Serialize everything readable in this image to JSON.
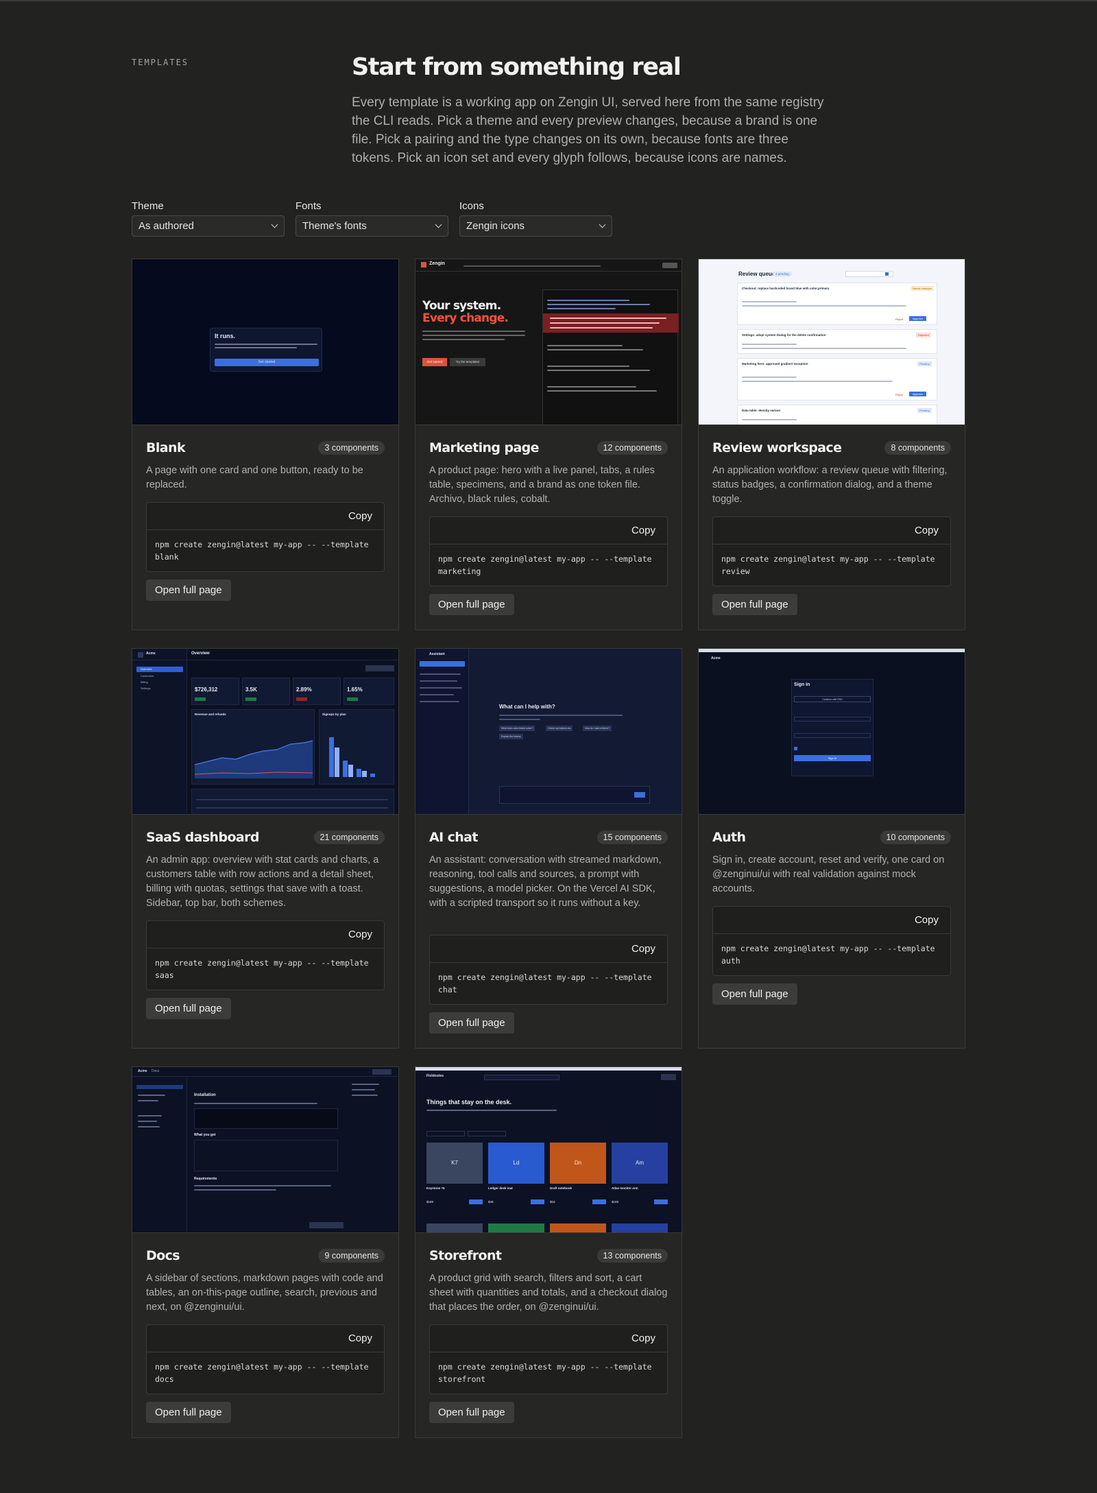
{
  "header": {
    "eyebrow": "TEMPLATES",
    "title": "Start from something real",
    "lede": "Every template is a working app on Zengin UI, served here from the same registry the CLI reads. Pick a theme and every preview changes, because a brand is one file. Pick a pairing and the type changes on its own, because fonts are three tokens. Pick an icon set and every glyph follows, because icons are names."
  },
  "filters": [
    {
      "label": "Theme",
      "value": "As authored"
    },
    {
      "label": "Fonts",
      "value": "Theme's fonts"
    },
    {
      "label": "Icons",
      "value": "Zengin icons"
    }
  ],
  "copy_label": "Copy",
  "open_label": "Open full page",
  "templates": [
    {
      "title": "Blank",
      "badge": "3 components",
      "desc": "A page with one card and one button, ready to be replaced.",
      "cmd1": "npm create zengin@latest my-app -- --template",
      "cmd2": "blank"
    },
    {
      "title": "Marketing page",
      "badge": "12 components",
      "desc": "A product page: hero with a live panel, tabs, a rules table, specimens, and a brand as one token file. Archivo, black rules, cobalt.",
      "cmd1": "npm create zengin@latest my-app -- --template",
      "cmd2": "marketing"
    },
    {
      "title": "Review workspace",
      "badge": "8 components",
      "desc": "An application workflow: a review queue with filtering, status badges, a confirmation dialog, and a theme toggle.",
      "cmd1": "npm create zengin@latest my-app -- --template",
      "cmd2": "review"
    },
    {
      "title": "SaaS dashboard",
      "badge": "21 components",
      "desc": "An admin app: overview with stat cards and charts, a customers table with row actions and a detail sheet, billing with quotas, settings that save with a toast. Sidebar, top bar, both schemes.",
      "cmd1": "npm create zengin@latest my-app -- --template",
      "cmd2": "saas"
    },
    {
      "title": "AI chat",
      "badge": "15 components",
      "desc": "An assistant: conversation with streamed markdown, reasoning, tool calls and sources, a prompt with suggestions, a model picker. On the Vercel AI SDK, with a scripted transport so it runs without a key.",
      "cmd1": "npm create zengin@latest my-app -- --template",
      "cmd2": "chat"
    },
    {
      "title": "Auth",
      "badge": "10 components",
      "desc": "Sign in, create account, reset and verify, one card on @zenginui/ui with real validation against mock accounts.",
      "cmd1": "npm create zengin@latest my-app -- --template",
      "cmd2": "auth"
    },
    {
      "title": "Docs",
      "badge": "9 components",
      "desc": "A sidebar of sections, markdown pages with code and tables, an on-this-page outline, search, previous and next, on @zenginui/ui.",
      "cmd1": "npm create zengin@latest my-app -- --template",
      "cmd2": "docs"
    },
    {
      "title": "Storefront",
      "badge": "13 components",
      "desc": "A product grid with search, filters and sort, a cart sheet with quantities and totals, and a checkout dialog that places the order, on @zenginui/ui.",
      "cmd1": "npm create zengin@latest my-app -- --template",
      "cmd2": "storefront"
    }
  ],
  "previews": {
    "blank": {
      "title": "It runs.",
      "button": "Get started"
    },
    "marketing": {
      "brand": "Zengin",
      "line1": "Your system.",
      "line2": "Every change.",
      "cta1": "Get started",
      "cta2": "Try the templates"
    },
    "review": {
      "title": "Review queue",
      "count": "3 pending",
      "items": [
        "Checkout: replace hardcoded brand blue with color.primary",
        "Settings: adopt system Dialog for the delete confirmation",
        "Marketing hero: approved gradient exception",
        "Data table: density variant"
      ],
      "statuses": [
        "Needs changes",
        "Rejected",
        "Pending",
        "Pending"
      ],
      "approve": "Approve",
      "reject": "Reject"
    },
    "saas": {
      "app": "Acme",
      "page": "Overview",
      "stats": [
        "$726,312",
        "3.5K",
        "2.89%",
        "1.65%"
      ],
      "nav": [
        "Overview",
        "Customers",
        "Billing",
        "Settings"
      ],
      "chart1": "Revenue and refunds",
      "chart2": "Signups by plan"
    },
    "chat": {
      "app": "Assistant",
      "question": "What can I help with?",
      "chips": [
        "What does color.brand solve?",
        "Check my buttons.tsx",
        "How do I add a theme?",
        "Explain the tokens"
      ]
    },
    "auth": {
      "app": "Acme",
      "title": "Sign in",
      "button": "Sign in",
      "sso": "Continue with SSO"
    },
    "docs": {
      "app": "Acme",
      "section": "Docs",
      "page": "Installation",
      "h2": "What you get",
      "h3": "Requirements"
    },
    "store": {
      "app": "Fieldnotes",
      "title": "Things that stay on the desk.",
      "products": [
        "K7",
        "Ld",
        "Dn",
        "Am"
      ],
      "names": [
        "Keystone 75",
        "Ledger desk mat",
        "Draft notebook",
        "Atlas monitor arm"
      ],
      "prices": [
        "$189",
        "$48",
        "$16",
        "$169"
      ]
    }
  }
}
